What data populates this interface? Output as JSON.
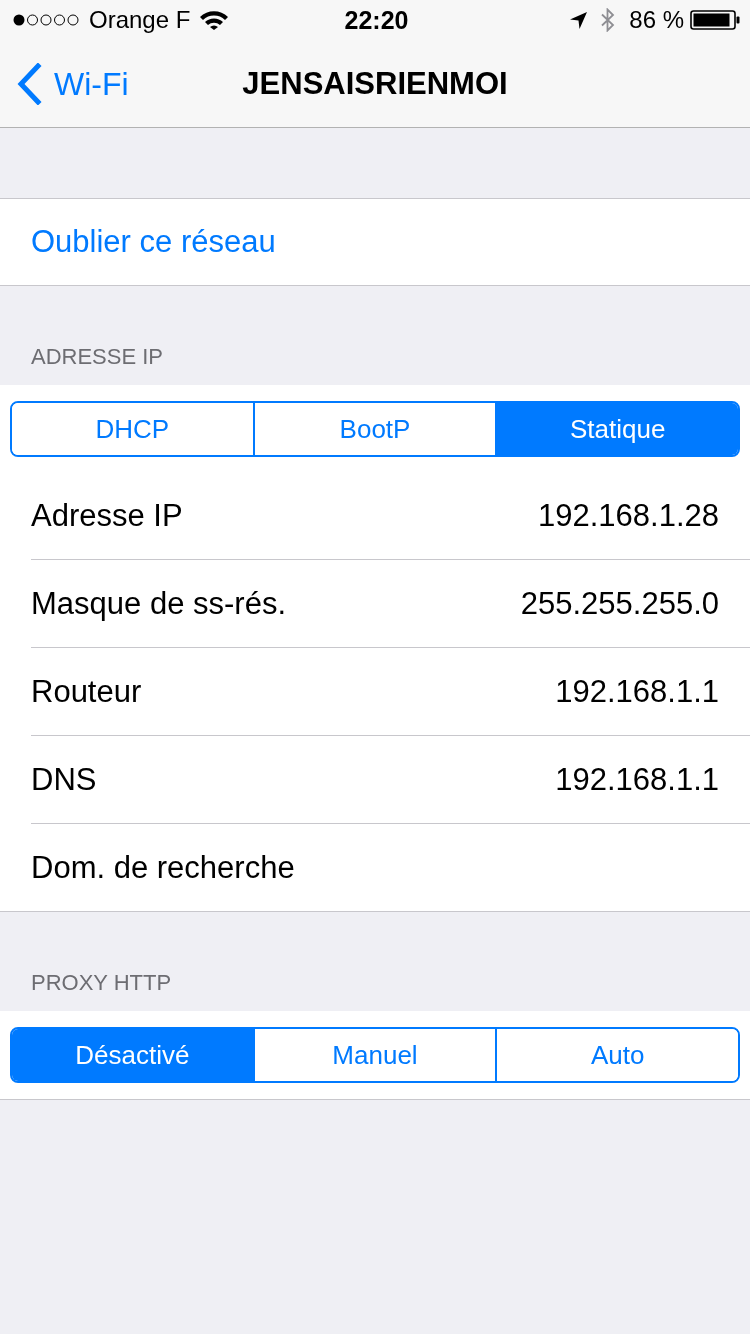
{
  "status_bar": {
    "carrier": "Orange F",
    "time": "22:20",
    "battery": "86 %"
  },
  "nav_bar": {
    "back": "Wi-Fi",
    "title": "JENSAISRIENMOI"
  },
  "forget_action": "Oublier ce réseau",
  "sections": [
    {
      "header": "ADRESSE IP",
      "segments": [
        {
          "label": "DHCP",
          "selected": false
        },
        {
          "label": "BootP",
          "selected": false
        },
        {
          "label": "Statique",
          "selected": true
        }
      ],
      "rows": [
        {
          "label": "Adresse IP",
          "value": "192.168.1.28"
        },
        {
          "label": "Masque de ss-rés.",
          "value": "255.255.255.0"
        },
        {
          "label": "Routeur",
          "value": "192.168.1.1"
        },
        {
          "label": "DNS",
          "value": "192.168.1.1"
        },
        {
          "label": "Dom. de recherche"
        }
      ]
    },
    {
      "header": "PROXY HTTP",
      "segments": [
        {
          "label": "Désactivé",
          "selected": true
        },
        {
          "label": "Manuel",
          "selected": false
        },
        {
          "label": "Auto",
          "selected": false
        }
      ]
    }
  ]
}
